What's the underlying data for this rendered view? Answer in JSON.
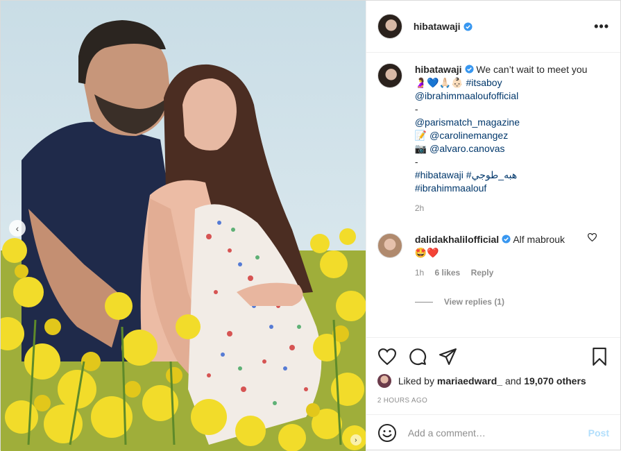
{
  "header": {
    "username": "hibatawaji",
    "more_label": "•••"
  },
  "caption": {
    "username": "hibatawaji",
    "text_start": "We can’t wait to meet you",
    "emojis": "🤰💙🙏🏻👶🏻",
    "hashtag1": "#itsaboy",
    "mention1": "@ibrahimmaaloufofficial",
    "dash1": "-",
    "mention2": "@parismatch_magazine",
    "memo_emoji": "📝",
    "mention3": "@carolinemangez",
    "camera_emoji": "📷",
    "mention4": "@alvaro.canovas",
    "dash2": "-",
    "hashtag2": "#hibatawaji",
    "hashtag3": "#هبه_طوجي",
    "hashtag4": "#ibrahimmaalouf",
    "time": "2h"
  },
  "comment": {
    "username": "dalidakhalilofficial",
    "text": "Alf mabrouk",
    "emojis": "🤩❤️",
    "time": "1h",
    "likes": "6 likes",
    "reply": "Reply",
    "view_replies": "View replies (1)"
  },
  "likes": {
    "prefix": "Liked by",
    "user": "mariaedward_",
    "and": "and",
    "others": "19,070 others"
  },
  "timestamp": "2 HOURS AGO",
  "add_comment": {
    "placeholder": "Add a comment…",
    "post_label": "Post"
  },
  "colors": {
    "link": "#00376b",
    "verified": "#3897f0",
    "post_disabled": "#b2dffc",
    "muted": "#8e8e8e"
  }
}
